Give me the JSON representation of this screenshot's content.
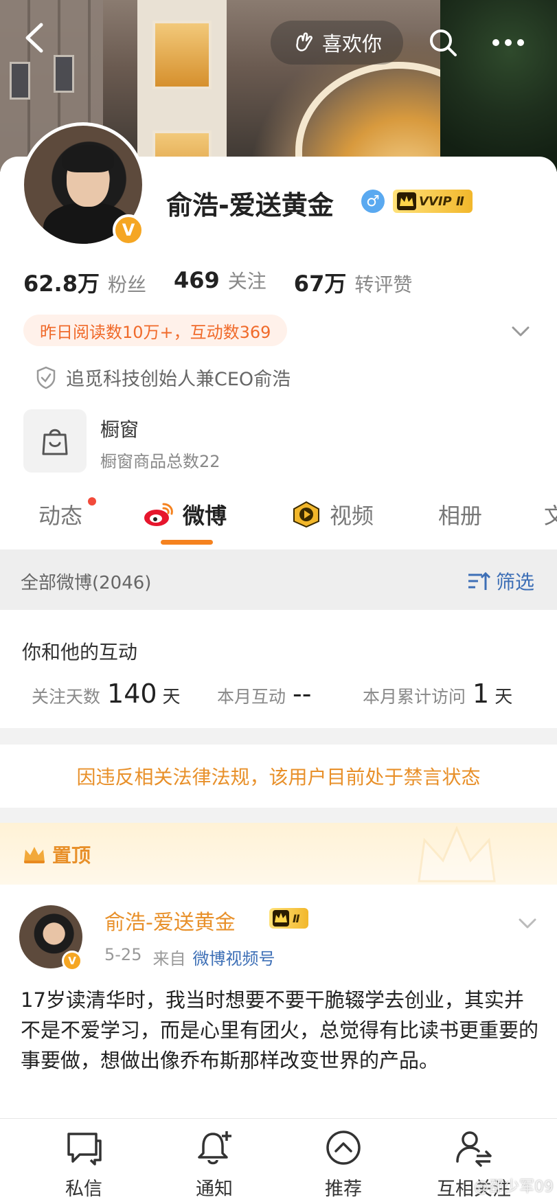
{
  "header": {
    "like_label": "喜欢你"
  },
  "profile": {
    "username": "俞浩-爱送黄金",
    "vip_label": "VVIP Ⅱ",
    "stats": [
      {
        "num": "62.8万",
        "label": "粉丝"
      },
      {
        "num": "469",
        "label": "关注"
      },
      {
        "num": "67万",
        "label": "转评赞"
      }
    ],
    "read_pill": "昨日阅读数10万+，互动数369",
    "verified": "追觅科技创始人兼CEO俞浩",
    "shop_title": "橱窗",
    "shop_sub": "橱窗商品总数22"
  },
  "tabs": [
    {
      "label": "动态"
    },
    {
      "label": "微博"
    },
    {
      "label": "视频"
    },
    {
      "label": "相册"
    },
    {
      "label": "文"
    }
  ],
  "filter": {
    "title": "全部微博(2046)",
    "button": "筛选"
  },
  "interaction": {
    "title": "你和他的互动",
    "items": [
      {
        "label": "关注天数",
        "value": "140",
        "unit": "天"
      },
      {
        "label": "本月互动",
        "value": "--",
        "unit": ""
      },
      {
        "label": "本月累计访问",
        "value": "1",
        "unit": "天"
      }
    ]
  },
  "ban_notice": "因违反相关法律法规，该用户目前处于禁言状态",
  "pinned": {
    "label": "置顶"
  },
  "post": {
    "name": "俞浩-爱送黄金",
    "vip_label": "Ⅱ",
    "date": "5-25",
    "from": "来自",
    "source": "微博视频号",
    "text": "17岁读清华时，我当时想要不要干脆辍学去创业，其实并不是不爱学习，而是心里有团火，总觉得有比读书更重要的事要做，想做出像乔布斯那样改变世界的产品。"
  },
  "bottom_bar": [
    {
      "label": "私信",
      "icon": "message-icon"
    },
    {
      "label": "通知",
      "icon": "bell-plus-icon"
    },
    {
      "label": "推荐",
      "icon": "recommend-icon"
    },
    {
      "label": "互相关注",
      "icon": "mutual-follow-icon"
    }
  ],
  "watermark": "@邵少军09",
  "colors": {
    "accent_orange": "#f5821f",
    "link_blue": "#3d6fb6",
    "ban_orange": "#e8902a"
  }
}
